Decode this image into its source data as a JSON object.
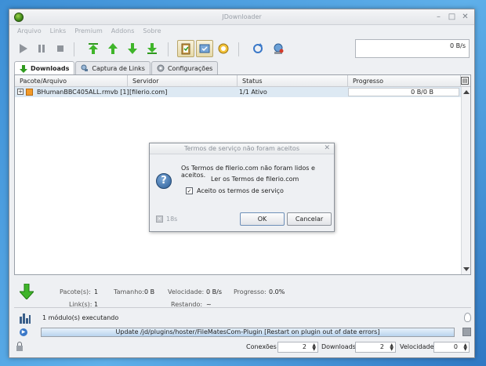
{
  "window": {
    "title": "JDownloader"
  },
  "menu": [
    "Arquivo",
    "Links",
    "Premium",
    "Addons",
    "Sobre"
  ],
  "toolbar": {
    "speed_display": "0 B/s"
  },
  "tabs": [
    {
      "label": "Downloads",
      "active": true
    },
    {
      "label": "Captura de Links",
      "active": false
    },
    {
      "label": "Configurações",
      "active": false
    }
  ],
  "table": {
    "columns": [
      "Pacote/Arquivo",
      "Servidor",
      "Status",
      "Progresso"
    ],
    "rows": [
      {
        "expander": "+",
        "file": "BHumanBBC405ALL.rmvb [1]",
        "host": "[filerio.com]",
        "status": "1/1 Ativo",
        "progress": "0 B/0 B"
      }
    ]
  },
  "dialog": {
    "title": "Termos de serviço não foram aceitos",
    "line1": "Os Termos de filerio.com não foram lidos e aceitos.",
    "line2": "Ler os Termos de filerio.com",
    "checkbox_label": "Aceito os termos de serviço",
    "checkbox_mark": "✓",
    "timer": "18s",
    "ok": "OK",
    "cancel": "Cancelar"
  },
  "status": {
    "packages_label": "Pacote(s):",
    "packages": "1",
    "size_label": "Tamanho:",
    "size": "0 B",
    "speed_label": "Velocidade:",
    "speed": "0 B/s",
    "progress_label": "Progresso:",
    "progress": "0.0%",
    "links_label": "Link(s):",
    "links": "1",
    "remaining_label": "Restando:",
    "remaining": "~"
  },
  "modules": {
    "text": "1 módulo(s) executando"
  },
  "update": {
    "text": "Update /jd/plugins/hoster/FileMatesCom-Plugin [Restart on plugin out of date errors]"
  },
  "bottom": {
    "connections_label": "Conexões",
    "connections": "2",
    "downloads_label": "Downloads",
    "downloads": "2",
    "speed_label": "Velocidade",
    "speed": "0"
  },
  "colors": {
    "accent": "#3a78c8",
    "green": "#2f9a1e",
    "row_highlight": "#dde9f3"
  }
}
